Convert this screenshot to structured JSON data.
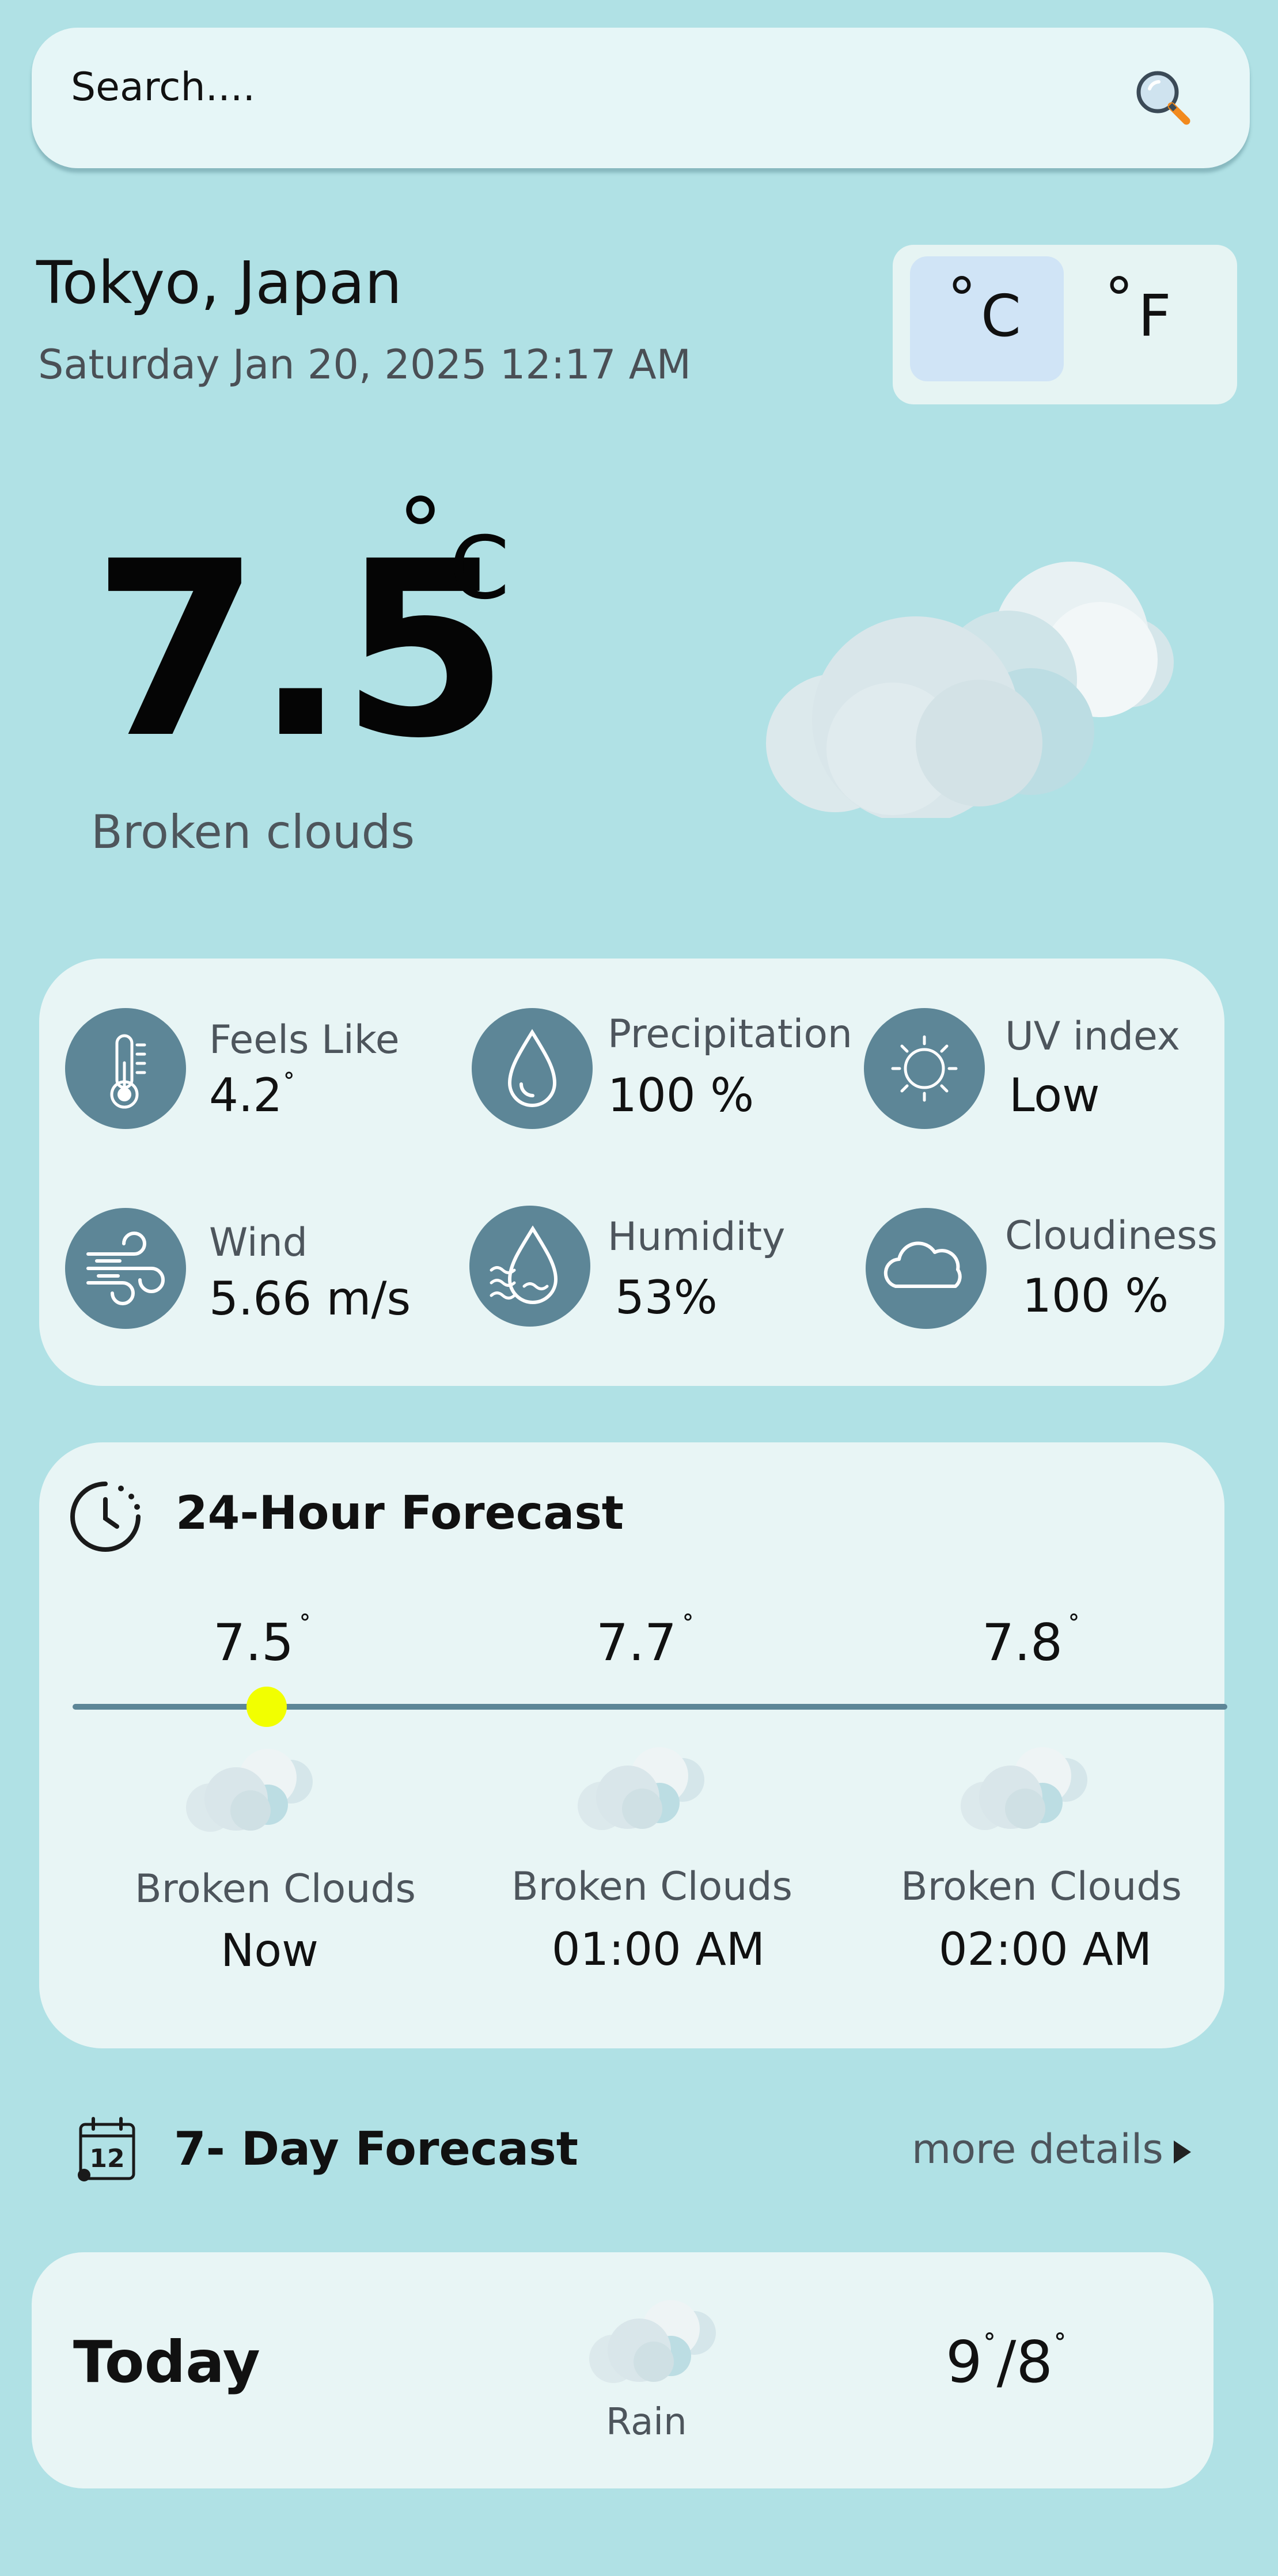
{
  "search": {
    "placeholder": "Search...."
  },
  "location": {
    "city": "Tokyo, Japan",
    "datetime": "Saturday Jan 20, 2025  12:17 AM"
  },
  "units": {
    "celsius": "C",
    "fahrenheit": "F",
    "degree": "°",
    "selected": "celsius"
  },
  "current": {
    "temp": "7.5",
    "unit_degree": "°",
    "unit": "C",
    "condition": "Broken clouds"
  },
  "stats": [
    {
      "label": "Feels Like",
      "value": "4.2",
      "suffix": "˚",
      "icon": "thermometer-icon"
    },
    {
      "label": "Precipitation",
      "value": "100 %",
      "suffix": "",
      "icon": "droplet-icon"
    },
    {
      "label": "UV index",
      "value": "Low",
      "suffix": "",
      "icon": "sun-icon"
    },
    {
      "label": "Wind",
      "value": "5.66 m/s",
      "suffix": "",
      "icon": "wind-icon"
    },
    {
      "label": "Humidity",
      "value": "53%",
      "suffix": "",
      "icon": "humidity-icon"
    },
    {
      "label": "Cloudiness",
      "value": "100 %",
      "suffix": "",
      "icon": "cloud-icon"
    }
  ],
  "hourly": {
    "title": "24-Hour Forecast",
    "items": [
      {
        "temp": "7.5",
        "deg": "˚",
        "condition": "Broken Clouds",
        "time": "Now"
      },
      {
        "temp": "7.7",
        "deg": "˚",
        "condition": "Broken Clouds",
        "time": "01:00 AM"
      },
      {
        "temp": "7.8",
        "deg": "˚",
        "condition": "Broken Clouds",
        "time": "02:00 AM"
      }
    ]
  },
  "weekly": {
    "title": "7- Day Forecast",
    "more_label": "more details",
    "calendar_day": "12",
    "days": [
      {
        "name": "Today",
        "condition": "Rain",
        "high": "9",
        "low": "8",
        "deg": "˚"
      }
    ]
  },
  "colors": {
    "background": "#b0e1e5",
    "card": "#e8f5f5",
    "icon_circle": "#5d8697",
    "accent_dot": "#f2ff00",
    "toggle_selected": "#d0e4f6"
  }
}
